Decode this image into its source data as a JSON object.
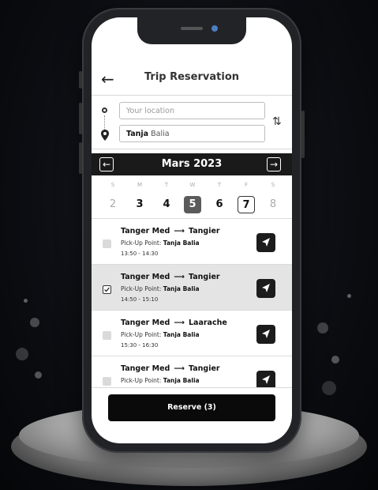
{
  "header": {
    "title": "Trip Reservation",
    "back_icon": "arrow-left-icon"
  },
  "search": {
    "from_placeholder": "Your location",
    "to_bold": "Tanja",
    "to_rest": " Balia",
    "swap_icon": "swap-vertical-icon"
  },
  "calendar": {
    "month": "Mars 2023",
    "weekdays": [
      "S",
      "M",
      "T",
      "W",
      "T",
      "F",
      "S"
    ],
    "days": [
      "2",
      "3",
      "4",
      "5",
      "6",
      "7",
      "8"
    ],
    "selected_day": "5",
    "outlined_day": "7"
  },
  "trips": [
    {
      "from": "Tanger Med",
      "arrow": "⟶",
      "to": "Tangier",
      "pickup_label": "Pick-Up Point: ",
      "pickup_value": "Tanja Balia",
      "time": "13:50 - 14:30",
      "checked": false
    },
    {
      "from": "Tanger Med",
      "arrow": "⟶",
      "to": "Tangier",
      "pickup_label": "Pick-Up Point: ",
      "pickup_value": "Tanja Balia",
      "time": "14:50 - 15:10",
      "checked": true
    },
    {
      "from": "Tanger Med",
      "arrow": "⟶",
      "to": "Laarache",
      "pickup_label": "Pick-Up Point: ",
      "pickup_value": "Tanja Balia",
      "time": "15:30 - 16:30",
      "checked": false
    },
    {
      "from": "Tanger Med",
      "arrow": "⟶",
      "to": "Tangier",
      "pickup_label": "Pick-Up Point: ",
      "pickup_value": "Tanja Balia",
      "time": "",
      "checked": false
    }
  ],
  "reserve_label": "Reserve (3)",
  "colors": {
    "accent": "#1a1a1a",
    "selected_row": "#e4e4e4",
    "selected_day": "#5b5b5b"
  }
}
